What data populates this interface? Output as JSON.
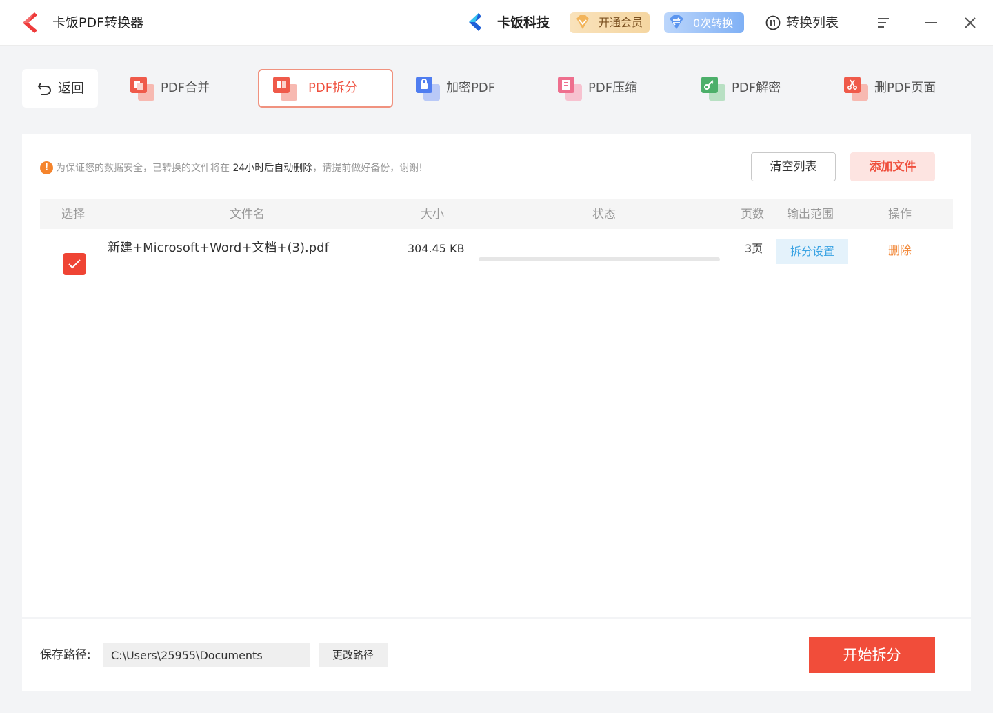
{
  "titlebar": {
    "app_title": "卡饭PDF转换器",
    "brand_name": "卡饭科技",
    "vip_label": "开通会员",
    "conversions_label": "0次转换",
    "list_label": "转换列表"
  },
  "toolbar": {
    "back_label": "返回",
    "tools": [
      {
        "label": "PDF合并",
        "icon": "pdf-merge-icon",
        "color": "#ef5a4a"
      },
      {
        "label": "PDF拆分",
        "icon": "pdf-split-icon",
        "color": "#ef5a4a",
        "active": true
      },
      {
        "label": "加密PDF",
        "icon": "pdf-encrypt-icon",
        "color": "#4f7df0"
      },
      {
        "label": "PDF压缩",
        "icon": "pdf-compress-icon",
        "color": "#ee6f8e"
      },
      {
        "label": "PDF解密",
        "icon": "pdf-decrypt-icon",
        "color": "#4caf6a"
      },
      {
        "label": "删PDF页面",
        "icon": "pdf-delete-pages-icon",
        "color": "#ef5a4a"
      }
    ]
  },
  "notice": {
    "pre": "为保证您的数据安全，已转换的文件将在",
    "emphasis": "24小时后自动删除",
    "post": "，请提前做好备份，谢谢!"
  },
  "actions": {
    "clear_label": "清空列表",
    "add_label": "添加文件"
  },
  "table": {
    "headers": {
      "select": "选择",
      "filename": "文件名",
      "size": "大小",
      "status": "状态",
      "pages": "页数",
      "range": "输出范围",
      "actions": "操作"
    },
    "rows": [
      {
        "checked": true,
        "filename": "新建+Microsoft+Word+文档+(3).pdf",
        "size": "304.45 KB",
        "progress": 0,
        "pages": "3页",
        "range_button": "拆分设置",
        "delete_label": "删除"
      }
    ]
  },
  "footer": {
    "path_label": "保存路径:",
    "path_value": "C:\\Users\\25955\\Documents",
    "change_label": "更改路径",
    "start_label": "开始拆分"
  },
  "colors": {
    "accent": "#ef4434",
    "accent_light": "#fde4e1",
    "link_blue": "#3aa3e3",
    "delete_orange": "#f28a3c"
  }
}
